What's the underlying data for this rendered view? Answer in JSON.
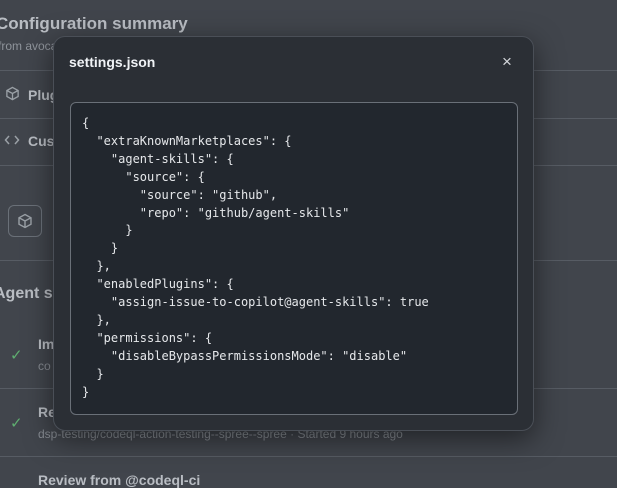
{
  "background": {
    "title": "Configuration summary",
    "subtitle": "from avoca",
    "rows": [
      {
        "label": "Plug",
        "icon": "cube-icon"
      },
      {
        "label": "Cus",
        "icon": "code-icon"
      }
    ],
    "section_title": "Agent se",
    "items": [
      {
        "title": "Im",
        "sub": "co"
      },
      {
        "title": "Re",
        "sub": "dsp-testing/codeql-action-testing--spree--spree · Started 9 hours ago"
      },
      {
        "title": "Review from @codeql-ci",
        "sub": ""
      }
    ]
  },
  "modal": {
    "title": "settings.json",
    "close_icon": "×",
    "code": "{\n  \"extraKnownMarketplaces\": {\n    \"agent-skills\": {\n      \"source\": {\n        \"source\": \"github\",\n        \"repo\": \"github/agent-skills\"\n      }\n    }\n  },\n  \"enabledPlugins\": {\n    \"assign-issue-to-copilot@agent-skills\": true\n  },\n  \"permissions\": {\n    \"disableBypassPermissionsMode\": \"disable\"\n  }\n}"
  },
  "colors": {
    "overlay": "#41454c",
    "modal_bg": "#2b2f35",
    "code_bg": "#22272e",
    "check": "#5fae70"
  }
}
